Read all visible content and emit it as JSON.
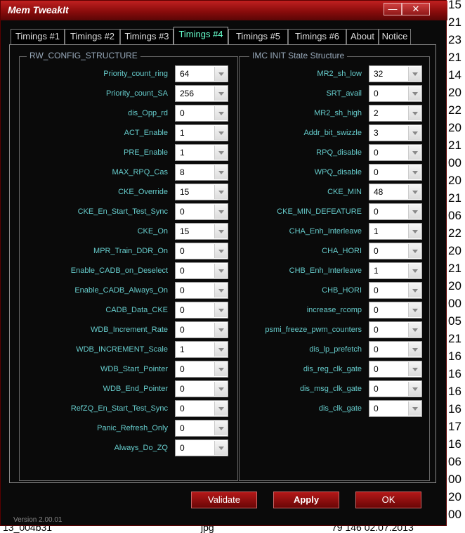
{
  "window": {
    "title": "Mem TweakIt",
    "minimize_glyph": "—",
    "close_glyph": "✕",
    "version": "Version 2.00.01"
  },
  "tabs": [
    {
      "label": "Timings #1"
    },
    {
      "label": "Timings #2"
    },
    {
      "label": "Timings #3"
    },
    {
      "label": "Timings #4",
      "active": true
    },
    {
      "label": "Timings #5"
    },
    {
      "label": "Timings #6"
    },
    {
      "label": "About"
    },
    {
      "label": "Notice"
    }
  ],
  "left_group": {
    "title": "RW_CONFIG_STRUCTURE",
    "rows": [
      {
        "label": "Priority_count_ring",
        "value": "64"
      },
      {
        "label": "Priority_count_SA",
        "value": "256"
      },
      {
        "label": "dis_Opp_rd",
        "value": "0"
      },
      {
        "label": "ACT_Enable",
        "value": "1"
      },
      {
        "label": "PRE_Enable",
        "value": "1"
      },
      {
        "label": "MAX_RPQ_Cas",
        "value": "8"
      },
      {
        "label": "CKE_Override",
        "value": "15"
      },
      {
        "label": "CKE_En_Start_Test_Sync",
        "value": "0"
      },
      {
        "label": "CKE_On",
        "value": "15"
      },
      {
        "label": "MPR_Train_DDR_On",
        "value": "0"
      },
      {
        "label": "Enable_CADB_on_Deselect",
        "value": "0"
      },
      {
        "label": "Enable_CADB_Always_On",
        "value": "0"
      },
      {
        "label": "CADB_Data_CKE",
        "value": "0"
      },
      {
        "label": "WDB_Increment_Rate",
        "value": "0"
      },
      {
        "label": "WDB_INCREMENT_Scale",
        "value": "1"
      },
      {
        "label": "WDB_Start_Pointer",
        "value": "0"
      },
      {
        "label": "WDB_End_Pointer",
        "value": "0"
      },
      {
        "label": "RefZQ_En_Start_Test_Sync",
        "value": "0"
      },
      {
        "label": "Panic_Refresh_Only",
        "value": "0"
      },
      {
        "label": "Always_Do_ZQ",
        "value": "0"
      }
    ]
  },
  "right_group": {
    "title": "IMC INIT State Structure",
    "rows": [
      {
        "label": "MR2_sh_low",
        "value": "32"
      },
      {
        "label": "SRT_avail",
        "value": "0"
      },
      {
        "label": "MR2_sh_high",
        "value": "2"
      },
      {
        "label": "Addr_bit_swizzle",
        "value": "3"
      },
      {
        "label": "RPQ_disable",
        "value": "0"
      },
      {
        "label": "WPQ_disable",
        "value": "0"
      },
      {
        "label": "CKE_MIN",
        "value": "48"
      },
      {
        "label": "CKE_MIN_DEFEATURE",
        "value": "0"
      },
      {
        "label": "CHA_Enh_Interleave",
        "value": "1"
      },
      {
        "label": "CHA_HORI",
        "value": "0"
      },
      {
        "label": "CHB_Enh_Interleave",
        "value": "1"
      },
      {
        "label": "CHB_HORI",
        "value": "0"
      },
      {
        "label": "increase_rcomp",
        "value": "0"
      },
      {
        "label": "psmi_freeze_pwm_counters",
        "value": "0"
      },
      {
        "label": "dis_lp_prefetch",
        "value": "0"
      },
      {
        "label": "dis_reg_clk_gate",
        "value": "0"
      },
      {
        "label": "dis_msg_clk_gate",
        "value": "0"
      },
      {
        "label": "dis_clk_gate",
        "value": "0"
      }
    ]
  },
  "buttons": {
    "validate": "Validate",
    "apply": "Apply",
    "ok": "OK"
  },
  "background": {
    "right_numbers": [
      "15",
      "21",
      "23",
      "21",
      "14",
      "20",
      "22",
      "20",
      "21",
      "00",
      "20",
      "21",
      "06",
      "22",
      "20",
      "21",
      "20",
      "00",
      "05",
      "21",
      "16",
      "16",
      "16",
      "16",
      "17",
      "16",
      "06",
      "00",
      "20",
      "00"
    ],
    "footer_left": "13_004b31",
    "footer_mid": "jpg",
    "footer_right": "79 146 02.07.2013"
  }
}
